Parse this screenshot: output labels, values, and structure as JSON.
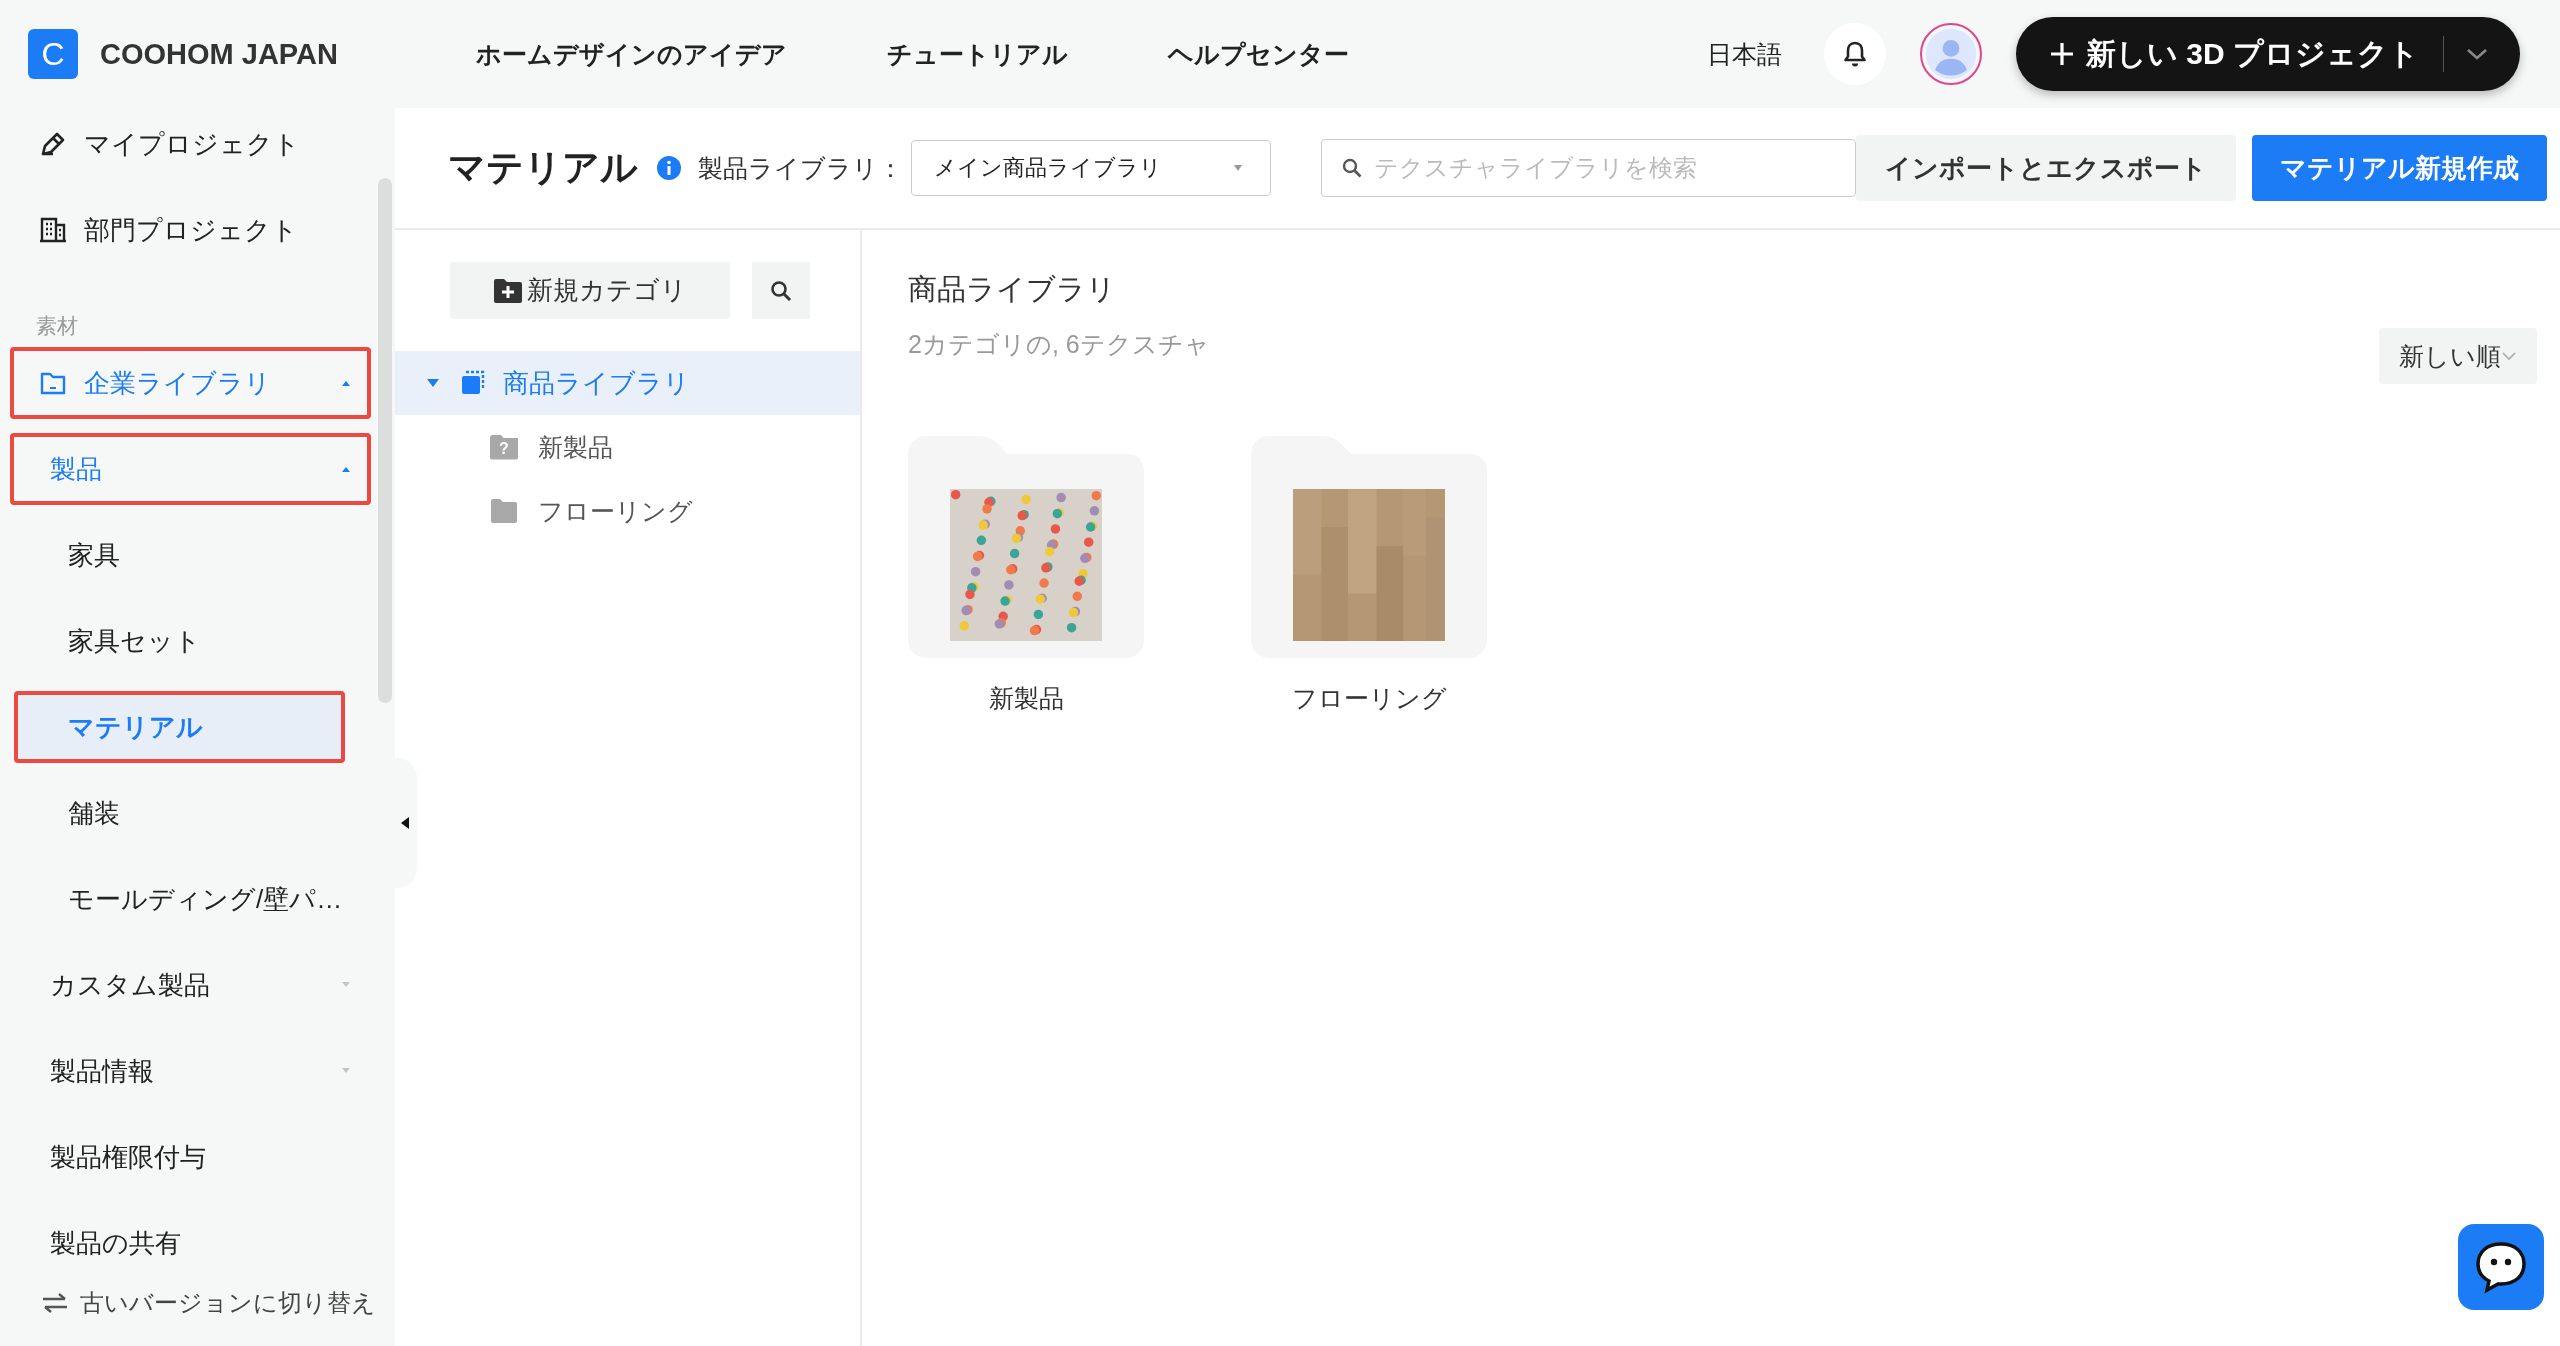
{
  "header": {
    "logo_letter": "C",
    "brand": "COOHOM JAPAN",
    "nav": [
      "ホームデザインのアイデア",
      "チュートリアル",
      "ヘルプセンター"
    ],
    "language": "日本語",
    "new_project_button": "新しい 3D プロジェクト"
  },
  "sidebar": {
    "items": [
      {
        "kind": "nav",
        "label": "マイプロジェクト",
        "selected": false
      },
      {
        "kind": "nav",
        "label": "部門プロジェクト",
        "selected": false
      },
      {
        "kind": "section",
        "label": "素材"
      },
      {
        "kind": "library",
        "label": "企業ライブラリ",
        "selected": true,
        "expanded": true,
        "outlined": true,
        "children": [
          {
            "kind": "group",
            "label": "製品",
            "selected": true,
            "expanded": true,
            "outlined": true,
            "children": [
              {
                "kind": "sub",
                "label": "家具",
                "selected": false,
                "outlined": false
              },
              {
                "kind": "sub",
                "label": "家具セット",
                "selected": false,
                "outlined": false
              },
              {
                "kind": "sub",
                "label": "マテリアル",
                "selected": true,
                "outlined": true
              },
              {
                "kind": "sub",
                "label": "舗装",
                "selected": false,
                "outlined": false
              },
              {
                "kind": "sub",
                "label": "モールディング/壁パ…",
                "selected": false,
                "outlined": false
              }
            ]
          },
          {
            "kind": "group",
            "label": "カスタム製品",
            "selected": false,
            "expanded": false,
            "outlined": false
          },
          {
            "kind": "group",
            "label": "製品情報",
            "selected": false,
            "expanded": false,
            "outlined": false
          },
          {
            "kind": "link",
            "label": "製品権限付与",
            "selected": false,
            "outlined": false
          },
          {
            "kind": "link",
            "label": "製品の共有",
            "selected": false,
            "outlined": false
          }
        ]
      }
    ],
    "footer_link": "古いバージョンに切り替え"
  },
  "toolbar": {
    "title": "マテリアル",
    "library_label": "製品ライブラリ：",
    "library_select": "メイン商品ライブラリ",
    "search_placeholder": "テクスチャライブラリを検索",
    "import_export_button": "インポートとエクスポート",
    "create_button": "マテリアル新規作成"
  },
  "category_panel": {
    "new_category_button": "新規カテゴリ",
    "tree": [
      {
        "label": "商品ライブラリ",
        "selected": true,
        "expanded": true,
        "children": [
          {
            "kind": "unsorted",
            "badge": "?",
            "label": "新製品",
            "selected": false
          },
          {
            "kind": "folder",
            "label": "フローリング",
            "selected": false
          }
        ]
      }
    ]
  },
  "content": {
    "title": "商品ライブラリ",
    "summary": "2カテゴリの, 6テクスチャ",
    "sort": "新しい順",
    "folders": [
      {
        "label": "新製品",
        "kind": "picture"
      },
      {
        "label": "フローリング",
        "kind": "picture"
      }
    ]
  }
}
